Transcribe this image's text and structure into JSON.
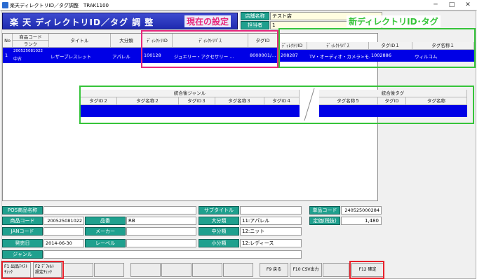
{
  "window": {
    "title": "楽天ディレクトリID／タグ調整　TRAK1100",
    "min": "─",
    "max": "□",
    "close": "✕"
  },
  "header": {
    "title": "楽 天 ディレクトリID／タグ 調 整"
  },
  "store": {
    "name_label": "店舗名称",
    "name_value": "テスト店",
    "person_label": "担当者",
    "person_value": "1"
  },
  "annotations": {
    "current": "現在の設定",
    "new": "新ディレクトリID･タグ"
  },
  "grid1": {
    "headers": {
      "no": "No",
      "code": "商品コード",
      "rank": "ランク",
      "title": "タイトル",
      "category": "大分類",
      "dir_id": "ﾃﾞｨﾚｸﾄﾘID",
      "dir_path": "ﾃﾞｨﾚｸﾄﾘﾊﾟｽ",
      "tag_id": "タグID",
      "new_dir_id": "ﾃﾞｨﾚｸﾄﾘID",
      "new_dir_path": "ﾃﾞｨﾚｸﾄﾘﾊﾟｽ",
      "new_tag_id1": "タグID１",
      "new_tag_name1": "タグ名称１"
    },
    "row": {
      "no": "1",
      "code": "200525081022",
      "rank": "中古",
      "title": "レザーブレスレット",
      "category": "アパレル",
      "dir_id": "100128",
      "dir_path": "ジュエリー・アクセサリー ...",
      "tag_id": "8000001/...",
      "new_dir_id": "208287",
      "new_dir_path": "TV・オーディオ・カメラ>モ...",
      "new_tag_id1": "1002886",
      "new_tag_name1": "ウィルコム"
    }
  },
  "grid2": {
    "group_genre": "統合後ジャンル",
    "group_tag": "統合後タグ",
    "headers": [
      "タグID２",
      "タグ名称２",
      "タグID３",
      "タグ名称３",
      "タグID４",
      "タグ名称５",
      "タグID",
      "タグ名称"
    ]
  },
  "detail": {
    "pos_name_label": "POS商品名称",
    "pos_name_value": "",
    "subtitle_label": "サブタイトル",
    "subtitle_value": "",
    "product_code_label": "商品コード",
    "product_code_value": "200525081022",
    "part_no_label": "品番",
    "part_no_value": "RB",
    "jan_label": "JANコード",
    "jan_value": "",
    "maker_label": "メーカー",
    "maker_value": "",
    "release_label": "発売日",
    "release_value": "2014-06-30",
    "label_label": "レーベル",
    "label_value": "",
    "genre_label": "ジャンル",
    "genre_value": "",
    "cat_large_label": "大分類",
    "cat_large_value": "11:アパレル",
    "cat_mid_label": "中分類",
    "cat_mid_value": "12:ニット",
    "cat_small_label": "小分類",
    "cat_small_value": "12:レディース",
    "unit_code_label": "単品コード",
    "unit_code_value": "240525000284",
    "price_label": "定価(税抜)",
    "price_value": "1,480"
  },
  "fkeys": {
    "f1": "F1 出品ﾃｷｽﾄ\nﾁｪｯｸ",
    "f2": "F2 ﾃﾞﾌｫﾙﾄ\n設定ﾁｪｯｸ",
    "f9": "F9 戻る",
    "f10": "F10 CSV出力",
    "f12": "F12 確定"
  }
}
